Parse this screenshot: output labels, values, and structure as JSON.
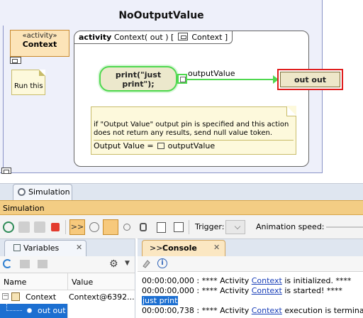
{
  "diagram": {
    "title": "NoOutputValue",
    "activity_class": {
      "stereotype": "«activity»",
      "name": "Context"
    },
    "note_small": "Run this",
    "activity_frame": {
      "keyword": "activity",
      "signature_pre": "Context( out ) [",
      "signature_name": "Context",
      "signature_post": "]"
    },
    "action": {
      "line1": "print(\"just",
      "line2": "print\");"
    },
    "pin_label": "outputValue",
    "out_node": "out out",
    "note_big": {
      "text": "if \"Output Value\" output pin is specified and this action does not return any results, send null value token.",
      "expr_key": "Output Value =",
      "expr_value": "outputValue"
    }
  },
  "simulation": {
    "tab_label": "Simulation",
    "title": "Simulation",
    "toolbar": {
      "selected_label": ">>",
      "trigger_label": "Trigger:",
      "animation_label": "Animation speed:"
    },
    "variables": {
      "tab_label": "Variables",
      "columns": {
        "name": "Name",
        "value": "Value"
      },
      "rows": [
        {
          "name": "Context",
          "value": "Context@6392..."
        },
        {
          "name": "out out",
          "value": ""
        }
      ]
    },
    "console": {
      "tab_label": "Console",
      "lines": [
        {
          "pre": "00:00:00,000 : **** Activity ",
          "link": "Context",
          "post": " is initialized. ****"
        },
        {
          "pre": "00:00:00,000 : **** Activity ",
          "link": "Context",
          "post": " is started! ****"
        },
        {
          "text": "just print"
        },
        {
          "pre": "00:00:00,738 : **** Activity ",
          "link": "Context",
          "post": " execution is terminated. **"
        }
      ]
    }
  },
  "colors": {
    "selection": "#1c6fd1",
    "flow": "#4fd84f",
    "highlight_border": "#e01e1e",
    "sim_bar": "#f3cd84"
  }
}
